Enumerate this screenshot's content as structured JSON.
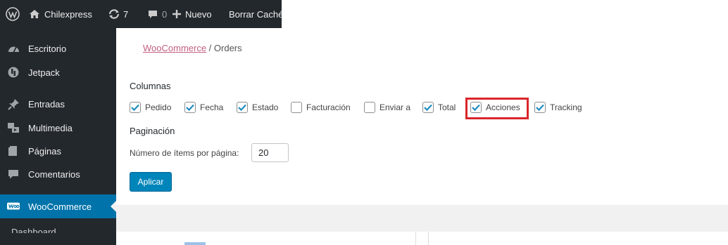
{
  "adminbar": {
    "site_name": "Chilexpress",
    "updates_count": "7",
    "comments_count": "0",
    "new_label": "Nuevo",
    "cache_label": "Borrar Caché"
  },
  "sidebar": {
    "items": [
      {
        "label": "Escritorio",
        "icon": "dashboard-icon"
      },
      {
        "label": "Jetpack",
        "icon": "jetpack-icon"
      },
      {
        "label": "Entradas",
        "icon": "pin-icon"
      },
      {
        "label": "Multimedia",
        "icon": "media-icon"
      },
      {
        "label": "Páginas",
        "icon": "pages-icon"
      },
      {
        "label": "Comentarios",
        "icon": "comments-icon"
      },
      {
        "label": "WooCommerce",
        "icon": "woocommerce-icon",
        "active": true
      }
    ],
    "submenu_hint": "Dashboard"
  },
  "breadcrumb": {
    "link": "WooCommerce",
    "separator": " / ",
    "current": "Orders"
  },
  "columns": {
    "title": "Columnas",
    "options": [
      {
        "label": "Pedido",
        "checked": true
      },
      {
        "label": "Fecha",
        "checked": true
      },
      {
        "label": "Estado",
        "checked": true
      },
      {
        "label": "Facturación",
        "checked": false
      },
      {
        "label": "Enviar a",
        "checked": false
      },
      {
        "label": "Total",
        "checked": true
      },
      {
        "label": "Acciones",
        "checked": true
      },
      {
        "label": "Tracking",
        "checked": true
      }
    ]
  },
  "pagination": {
    "title": "Paginación",
    "per_page_label": "Número de ítems por página:",
    "per_page_value": "20"
  },
  "apply_label": "Aplicar",
  "colors": {
    "adminbar_bg": "#23282d",
    "active_menu": "#0073aa",
    "button_blue": "#0085ba",
    "highlight_red": "#d9262b",
    "link_pink": "#c2607f"
  }
}
